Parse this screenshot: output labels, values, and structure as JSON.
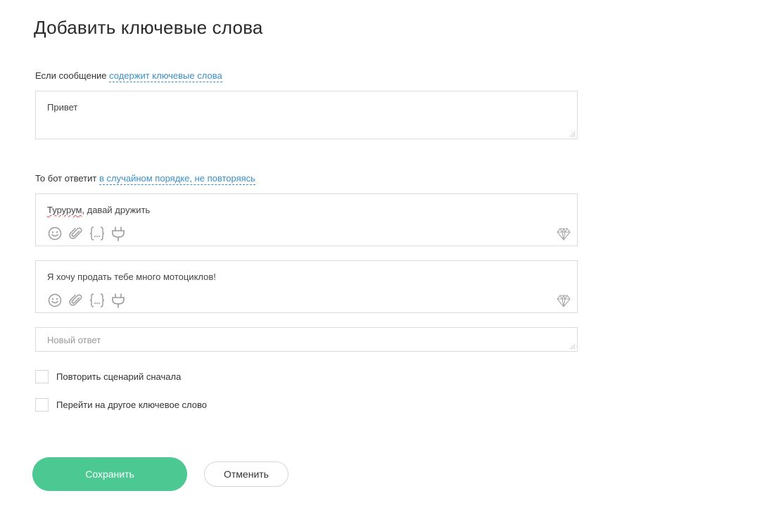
{
  "page": {
    "title": "Добавить ключевые слова"
  },
  "keywords_section": {
    "prefix": "Если сообщение ",
    "condition_link": "содержит ключевые слова",
    "value": "Привет"
  },
  "responses_section": {
    "prefix": "То бот ответит ",
    "order_link": "в случайном порядке, не повторяясь",
    "responses": [
      {
        "text_misspelled": "Турурум",
        "text_rest": ", давай дружить"
      },
      {
        "text": "Я хочу продать тебе много мотоциклов!"
      }
    ],
    "new_response_placeholder": "Новый ответ"
  },
  "options": {
    "repeat_label": "Повторить сценарий сначала",
    "goto_label": "Перейти на другое ключевое слово"
  },
  "buttons": {
    "save": "Сохранить",
    "cancel": "Отменить"
  },
  "colors": {
    "accent_green": "#4cc993",
    "link_blue": "#3a8fc8"
  },
  "icons": [
    "emoji-icon",
    "paperclip-icon",
    "variable-braces-icon",
    "plugin-icon",
    "diamond-icon"
  ]
}
